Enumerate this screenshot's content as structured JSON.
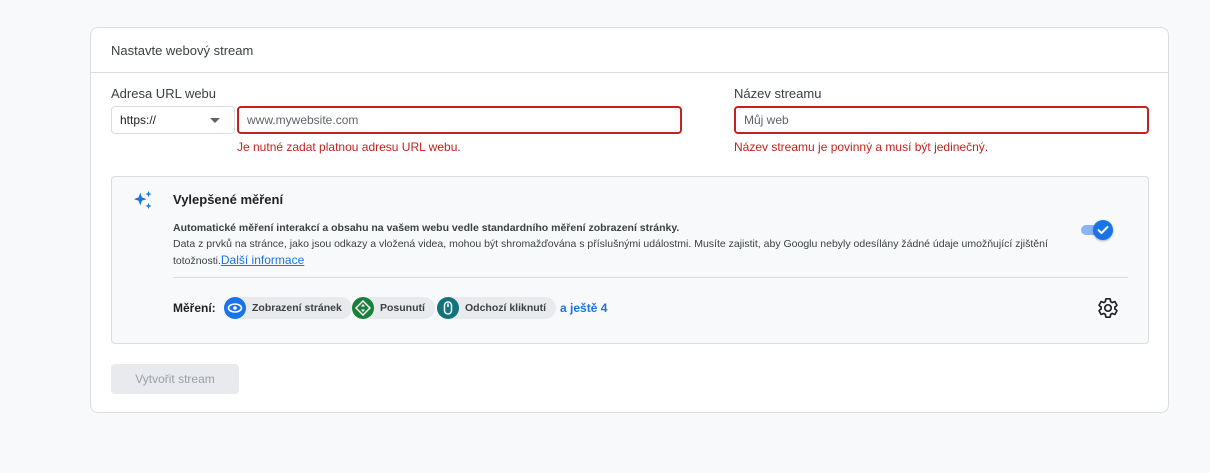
{
  "header": {
    "title": "Nastavte webový stream"
  },
  "url_field": {
    "label": "Adresa URL webu",
    "protocol": "https://",
    "placeholder": "www.mywebsite.com",
    "error": "Je nutné zadat platnou adresu URL webu."
  },
  "name_field": {
    "label": "Název streamu",
    "placeholder": "Můj web",
    "error": "Název streamu je povinný a musí být jedinečný."
  },
  "enhanced": {
    "title": "Vylepšené měření",
    "description_bold": "Automatické měření interakcí a obsahu na vašem webu vedle standardního měření zobrazení stránky.",
    "description": "Data z prvků na stránce, jako jsou odkazy a vložená videa, mohou být shromažďována s příslušnými událostmi. Musíte zajistit, aby Googlu nebyly odesílány žádné údaje umožňující zjištění totožnosti.",
    "learn_more": "Další informace",
    "toggle_on": true,
    "measure_label": "Měření:",
    "chips": [
      {
        "label": "Zobrazení stránek",
        "icon": "eye-icon",
        "color": "#1a73e8"
      },
      {
        "label": "Posunutí",
        "icon": "scroll-icon",
        "color": "#188038"
      },
      {
        "label": "Odchozí kliknutí",
        "icon": "mouse-icon",
        "color": "#12737b"
      }
    ],
    "more": "a ještě 4"
  },
  "actions": {
    "create": "Vytvořit stream"
  },
  "colors": {
    "accent": "#1a73e8",
    "error": "#c5221f"
  }
}
